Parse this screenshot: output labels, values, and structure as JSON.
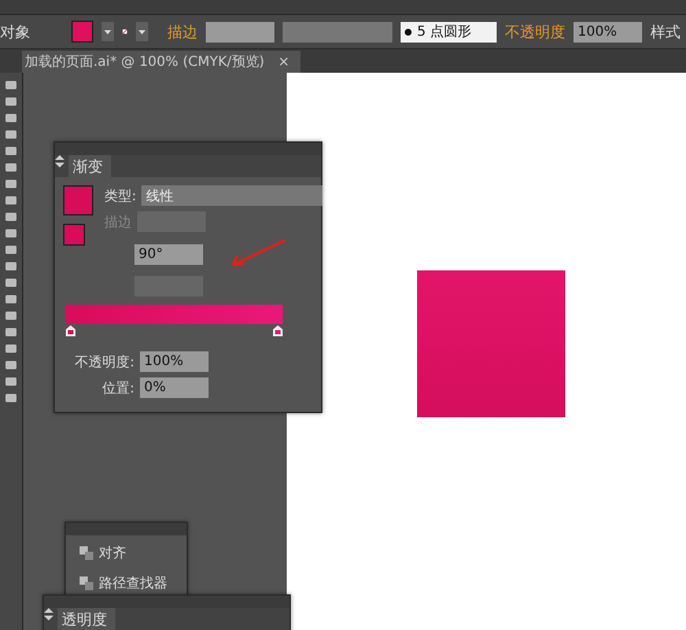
{
  "control_bar": {
    "object_label": "对象",
    "stroke_label": "描边",
    "brush": "5 点圆形",
    "opacity_label": "不透明度",
    "opacity": "100%",
    "style_label": "样式"
  },
  "document_tab": {
    "title": "加载的页面.ai* @ 100% (CMYK/预览)",
    "close": "×"
  },
  "gradient_panel": {
    "title": "渐变",
    "type_label": "类型:",
    "type": "线性",
    "stroke_label": "描边",
    "angle": "90°",
    "opacity_label": "不透明度:",
    "opacity": "100%",
    "location_label": "位置:",
    "location": "0%"
  },
  "floating_panel": {
    "items": [
      {
        "label": "对齐"
      },
      {
        "label": "路径查找器"
      }
    ]
  },
  "transparency_panel": {
    "title": "透明度"
  }
}
